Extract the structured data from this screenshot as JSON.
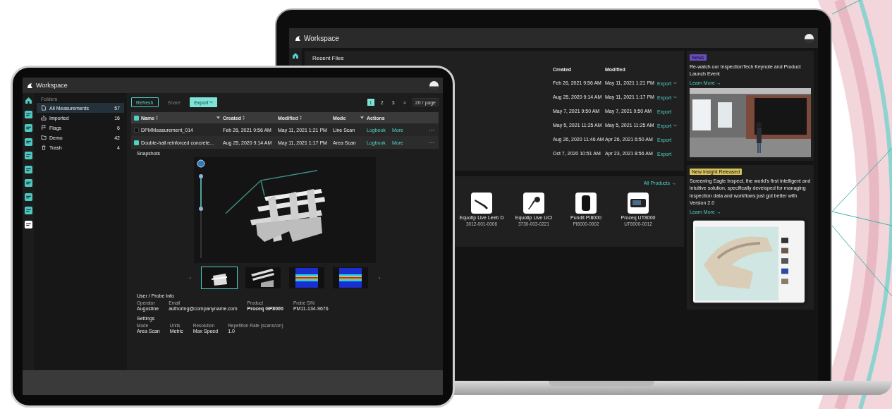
{
  "laptop": {
    "window": {
      "title": "Workspace"
    },
    "recent_files": {
      "title": "Recent Files",
      "columns": [
        "Created",
        "Modified"
      ],
      "rows": [
        {
          "created": "Feb 26, 2021 9:56 AM",
          "modified": "May 11, 2021 1:21 PM",
          "action": "Export",
          "dropdown": true
        },
        {
          "created": "Aug 25, 2020 9:14 AM",
          "modified": "May 11, 2021 1:17 PM",
          "action": "Export",
          "dropdown": true
        },
        {
          "created": "May 7, 2021 9:50 AM",
          "modified": "May 7, 2021 9:50 AM",
          "action": "Export",
          "dropdown": false
        },
        {
          "created": "May 5, 2021 11:25 AM",
          "modified": "May 5, 2021 11:25 AM",
          "action": "Export",
          "dropdown": true
        },
        {
          "created": "Aug 26, 2020 11:46 AM",
          "modified": "Apr 26, 2021 6:50 AM",
          "action": "Export",
          "dropdown": false
        },
        {
          "created": "Oct 7, 2020 10:51 AM",
          "modified": "Apr 23, 2021 8:56 AM",
          "action": "Export",
          "dropdown": false
        }
      ]
    },
    "products": {
      "link": "All Products →",
      "items": [
        {
          "name": "Equotip Live Leeb D",
          "code": "3012-001-0006",
          "kind": "probe"
        },
        {
          "name": "Equotip Live UCI",
          "code": "3730-003-0221",
          "kind": "pen"
        },
        {
          "name": "Pundit PI8000",
          "code": "PI8000-0002",
          "kind": "cylinder"
        },
        {
          "name": "Proceq UT8000",
          "code": "UT8000-0012",
          "kind": "device"
        }
      ]
    },
    "news": [
      {
        "badge": "News",
        "color": "#6a4cc2",
        "text": "Re-watch our InspectionTech Keynote and Product Launch Event",
        "link": "Learn More →"
      },
      {
        "badge": "New Insight Released",
        "color": "#d8c25a",
        "text": "Screening Eagle Inspect, the world's first intelligent and intuitive solution, specifically developed for managing inspection data and workflows just got better with Version 2.0",
        "link": "Learn More →"
      }
    ]
  },
  "tablet": {
    "window": {
      "title": "Workspace"
    },
    "rail": [
      {
        "kind": "home",
        "selected": false
      },
      {
        "kind": "app",
        "selected": false
      },
      {
        "kind": "app",
        "selected": false
      },
      {
        "kind": "app",
        "selected": false
      },
      {
        "kind": "app",
        "selected": false
      },
      {
        "kind": "app",
        "selected": false
      },
      {
        "kind": "app",
        "selected": false
      },
      {
        "kind": "app",
        "selected": false
      },
      {
        "kind": "app",
        "selected": false
      },
      {
        "kind": "app",
        "selected": true
      }
    ],
    "sidebar": {
      "header": "Folders",
      "items": [
        {
          "label": "All Measurements",
          "count": "57",
          "kind": "file",
          "selected": true
        },
        {
          "label": "Imported",
          "count": "16",
          "kind": "inbox",
          "selected": false
        },
        {
          "label": "Flags",
          "count": "6",
          "kind": "flag",
          "selected": false
        },
        {
          "label": "Demo",
          "count": "42",
          "kind": "folder",
          "selected": false
        },
        {
          "label": "Trash",
          "count": "4",
          "kind": "trash",
          "selected": false
        }
      ]
    },
    "toolbar": [
      {
        "label": "Refresh",
        "kind": "outline"
      },
      {
        "label": "Share",
        "kind": "disabled"
      },
      {
        "label": "Export",
        "kind": "primary"
      }
    ],
    "pagination": {
      "pages": [
        {
          "label": "1",
          "selected": true
        },
        {
          "label": "2",
          "selected": false
        },
        {
          "label": "3",
          "selected": false
        }
      ],
      "next": ">",
      "page_size": "20 / page"
    },
    "table": {
      "all_checked": true,
      "columns": [
        {
          "label": "Name",
          "sortable": true,
          "filter": true
        },
        {
          "label": "Created",
          "sortable": true,
          "filter": false
        },
        {
          "label": "Modified",
          "sortable": true,
          "filter": false
        },
        {
          "label": "Mode",
          "sortable": false,
          "filter": true
        },
        {
          "label": "Actions",
          "sortable": false,
          "filter": false
        }
      ],
      "rows": [
        {
          "checked": false,
          "name": "DPMMeasurement_014",
          "created": "Feb 26, 2021 9:56 AM",
          "modified": "May 11, 2021 1:21 PM",
          "mode": "Line Scan",
          "actions": [
            "Logbook",
            "More"
          ],
          "menu": "···"
        },
        {
          "checked": true,
          "name": "Double-hall reinforced concrete...",
          "created": "Aug 25, 2020 9:14 AM",
          "modified": "May 11, 2021 1:17 PM",
          "mode": "Area Scan",
          "actions": [
            "Logbook",
            "More"
          ],
          "menu": "···"
        }
      ]
    },
    "snapshots": {
      "title": "Snapshots",
      "prev": "‹",
      "next": "›",
      "thumbnails": [
        {
          "kind": "model",
          "selected": true
        },
        {
          "kind": "slices",
          "selected": false
        },
        {
          "kind": "heatmap",
          "selected": false
        },
        {
          "kind": "heatmap",
          "selected": false
        }
      ]
    },
    "user_probe": {
      "title": "User / Probe Info",
      "fields": [
        {
          "label": "Operator",
          "value": "Augustine",
          "bold": false
        },
        {
          "label": "Email",
          "value": "authoring@companyname.com",
          "bold": false
        },
        {
          "label": "Product",
          "value": "Proceq GP8000",
          "bold": true
        },
        {
          "label": "Probe S/N",
          "value": "PM11-134-9676",
          "bold": false
        }
      ]
    },
    "settings": {
      "title": "Settings",
      "fields": [
        {
          "label": "Mode",
          "value": "Area Scan",
          "bold": false
        },
        {
          "label": "Units",
          "value": "Metric",
          "bold": false
        },
        {
          "label": "Resolution",
          "value": "Max Speed",
          "bold": false
        },
        {
          "label": "Repetition Rate (scans/cm)",
          "value": "1.0",
          "bold": false
        }
      ]
    }
  }
}
